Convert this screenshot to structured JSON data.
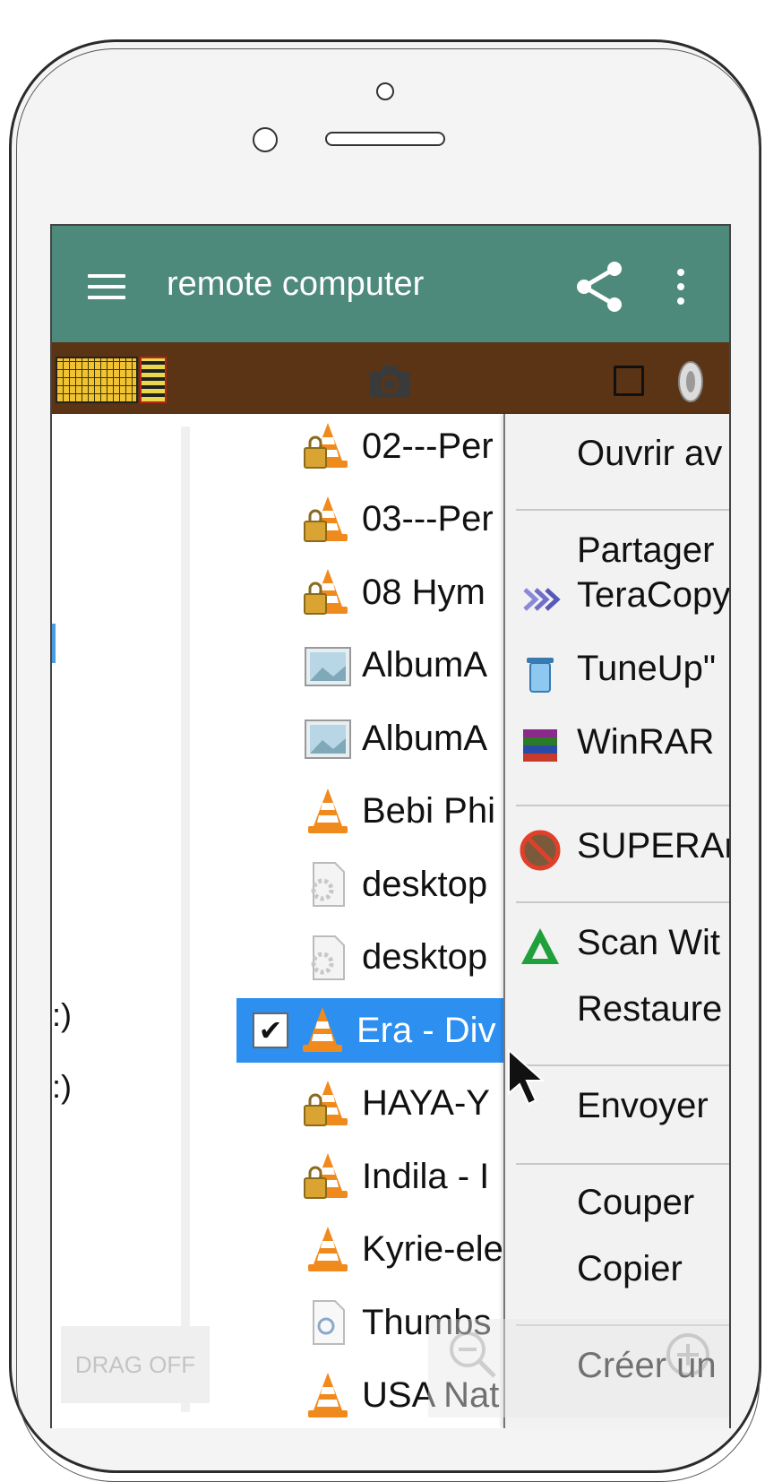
{
  "app": {
    "title": "remote computer",
    "appbar_color": "#4e8a7c",
    "toolbar_color": "#5a3414"
  },
  "icons": {
    "menu": "hamburger-menu-icon",
    "share": "share-icon",
    "more": "more-vertical-icon",
    "keyboard": "keyboard-icon",
    "camera": "camera-icon",
    "square": "stop-square-icon",
    "speaker": "speaker-icon"
  },
  "left_pane": {
    "drives": [
      ":)",
      ":)"
    ]
  },
  "files": [
    {
      "name": "02---Per",
      "icon": "vlc-locked-icon",
      "selected": false
    },
    {
      "name": "03---Per",
      "icon": "vlc-locked-icon",
      "selected": false
    },
    {
      "name": "08 Hym",
      "icon": "vlc-locked-icon",
      "selected": false
    },
    {
      "name": "AlbumA",
      "icon": "image-file-icon",
      "selected": false
    },
    {
      "name": "AlbumA",
      "icon": "image-file-icon",
      "selected": false
    },
    {
      "name": "Bebi Phi",
      "icon": "vlc-icon",
      "selected": false
    },
    {
      "name": "desktop",
      "icon": "settings-file-icon",
      "selected": false
    },
    {
      "name": "desktop",
      "icon": "settings-file-icon",
      "selected": false
    },
    {
      "name": "Era - Div",
      "icon": "vlc-icon",
      "selected": true
    },
    {
      "name": "HAYA-Y",
      "icon": "vlc-locked-icon",
      "selected": false
    },
    {
      "name": "Indila - I",
      "icon": "vlc-locked-icon",
      "selected": false
    },
    {
      "name": "Kyrie-ele",
      "icon": "vlc-icon",
      "selected": false
    },
    {
      "name": "Thumbs",
      "icon": "db-file-icon",
      "selected": false
    },
    {
      "name": "USA Nat",
      "icon": "vlc-icon",
      "selected": false
    }
  ],
  "context_menu": {
    "items": [
      {
        "label": "Ouvrir av",
        "icon": ""
      },
      {
        "label": "Partager",
        "icon": ""
      },
      {
        "label": "TeraCopy",
        "icon": "teracopy-icon"
      },
      {
        "label": "TuneUp\"",
        "icon": "tuneup-trash-icon"
      },
      {
        "label": "WinRAR",
        "icon": "winrar-icon"
      },
      {
        "label": "SUPERAn",
        "icon": "superantispyware-icon"
      },
      {
        "label": "Scan Wit",
        "icon": "scan-triangle-icon"
      },
      {
        "label": "Restaure",
        "icon": ""
      },
      {
        "label": "Envoyer",
        "icon": ""
      },
      {
        "label": "Couper",
        "icon": ""
      },
      {
        "label": "Copier",
        "icon": ""
      },
      {
        "label": "Créer un",
        "icon": ""
      }
    ]
  },
  "controls": {
    "drag_label": "DRAG OFF",
    "zoom_out": "zoom-out-icon",
    "zoom_in": "zoom-in-icon"
  }
}
